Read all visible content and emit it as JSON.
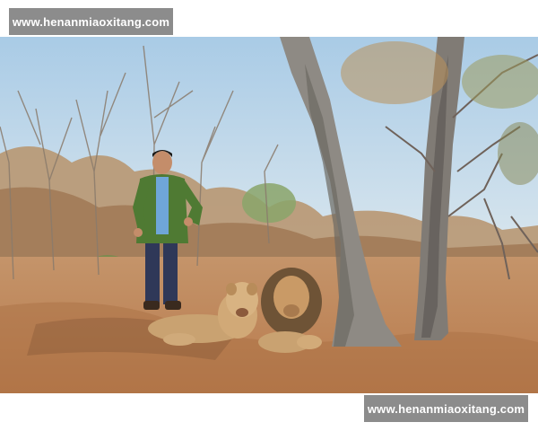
{
  "watermark_top": "www.henanmiaoxitang.com",
  "watermark_bottom": "www.henanmiaoxitang.com",
  "scene": {
    "sky_color": "#bcd6ea",
    "ground_color": "#c98f5f"
  }
}
